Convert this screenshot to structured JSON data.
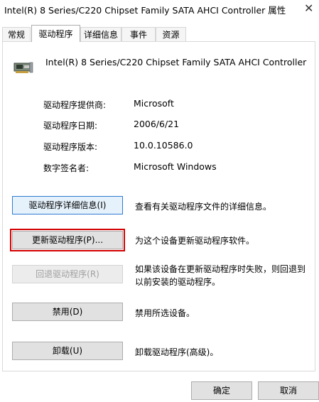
{
  "window": {
    "title": "Intel(R) 8 Series/C220 Chipset Family SATA AHCI Controller  属性",
    "close_glyph": "✕"
  },
  "tabs": [
    {
      "label": "常规"
    },
    {
      "label": "驱动程序"
    },
    {
      "label": "详细信息"
    },
    {
      "label": "事件"
    },
    {
      "label": "资源"
    }
  ],
  "device": {
    "name": "Intel(R) 8 Series/C220 Chipset Family SATA AHCI Controller",
    "icon": "controller-card-icon"
  },
  "info": [
    {
      "label": "驱动程序提供商:",
      "value": "Microsoft"
    },
    {
      "label": "驱动程序日期:",
      "value": "2006/6/21"
    },
    {
      "label": "驱动程序版本:",
      "value": "10.0.10586.0"
    },
    {
      "label": "数字签名者:",
      "value": "Microsoft Windows"
    }
  ],
  "actions": [
    {
      "label": "驱动程序详细信息(I)",
      "description": "查看有关驱动程序文件的详细信息。",
      "state": "focused"
    },
    {
      "label": "更新驱动程序(P)...",
      "description": "为这个设备更新驱动程序软件。",
      "state": "highlighted",
      "highlight_color": "#d40000"
    },
    {
      "label": "回退驱动程序(R)",
      "description": "如果该设备在更新驱动程序时失败，则回退到以前安装的驱动程序。",
      "state": "disabled"
    },
    {
      "label": "禁用(D)",
      "description": "禁用所选设备。",
      "state": "normal"
    },
    {
      "label": "卸载(U)",
      "description": "卸载驱动程序(高级)。",
      "state": "normal"
    }
  ],
  "footer": {
    "ok_label": "确定",
    "cancel_label": "取消"
  }
}
